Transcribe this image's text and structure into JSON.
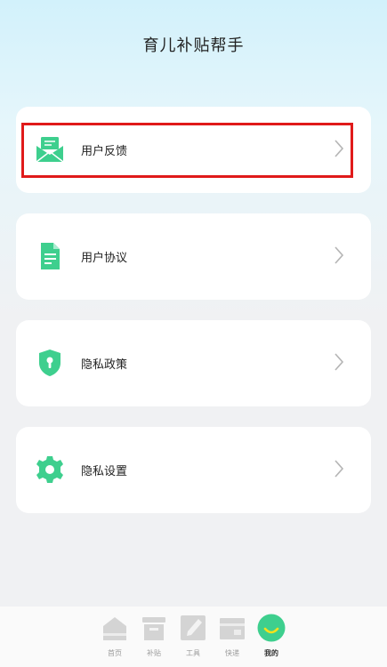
{
  "header": {
    "title": "育儿补贴帮手"
  },
  "menu": [
    {
      "label": "用户反馈",
      "icon": "mail-icon"
    },
    {
      "label": "用户协议",
      "icon": "document-icon"
    },
    {
      "label": "隐私政策",
      "icon": "shield-icon"
    },
    {
      "label": "隐私设置",
      "icon": "gear-icon"
    }
  ],
  "tabbar": [
    {
      "label": "首页",
      "icon": "home-icon"
    },
    {
      "label": "补贴",
      "icon": "inbox-icon"
    },
    {
      "label": "工具",
      "icon": "pencil-icon"
    },
    {
      "label": "快递",
      "icon": "box-icon"
    },
    {
      "label": "我的",
      "icon": "smile-icon"
    }
  ],
  "colors": {
    "accent": "#3ecf8e",
    "highlight": "#e01a1a",
    "inactive_tab": "#d4d4d4"
  }
}
